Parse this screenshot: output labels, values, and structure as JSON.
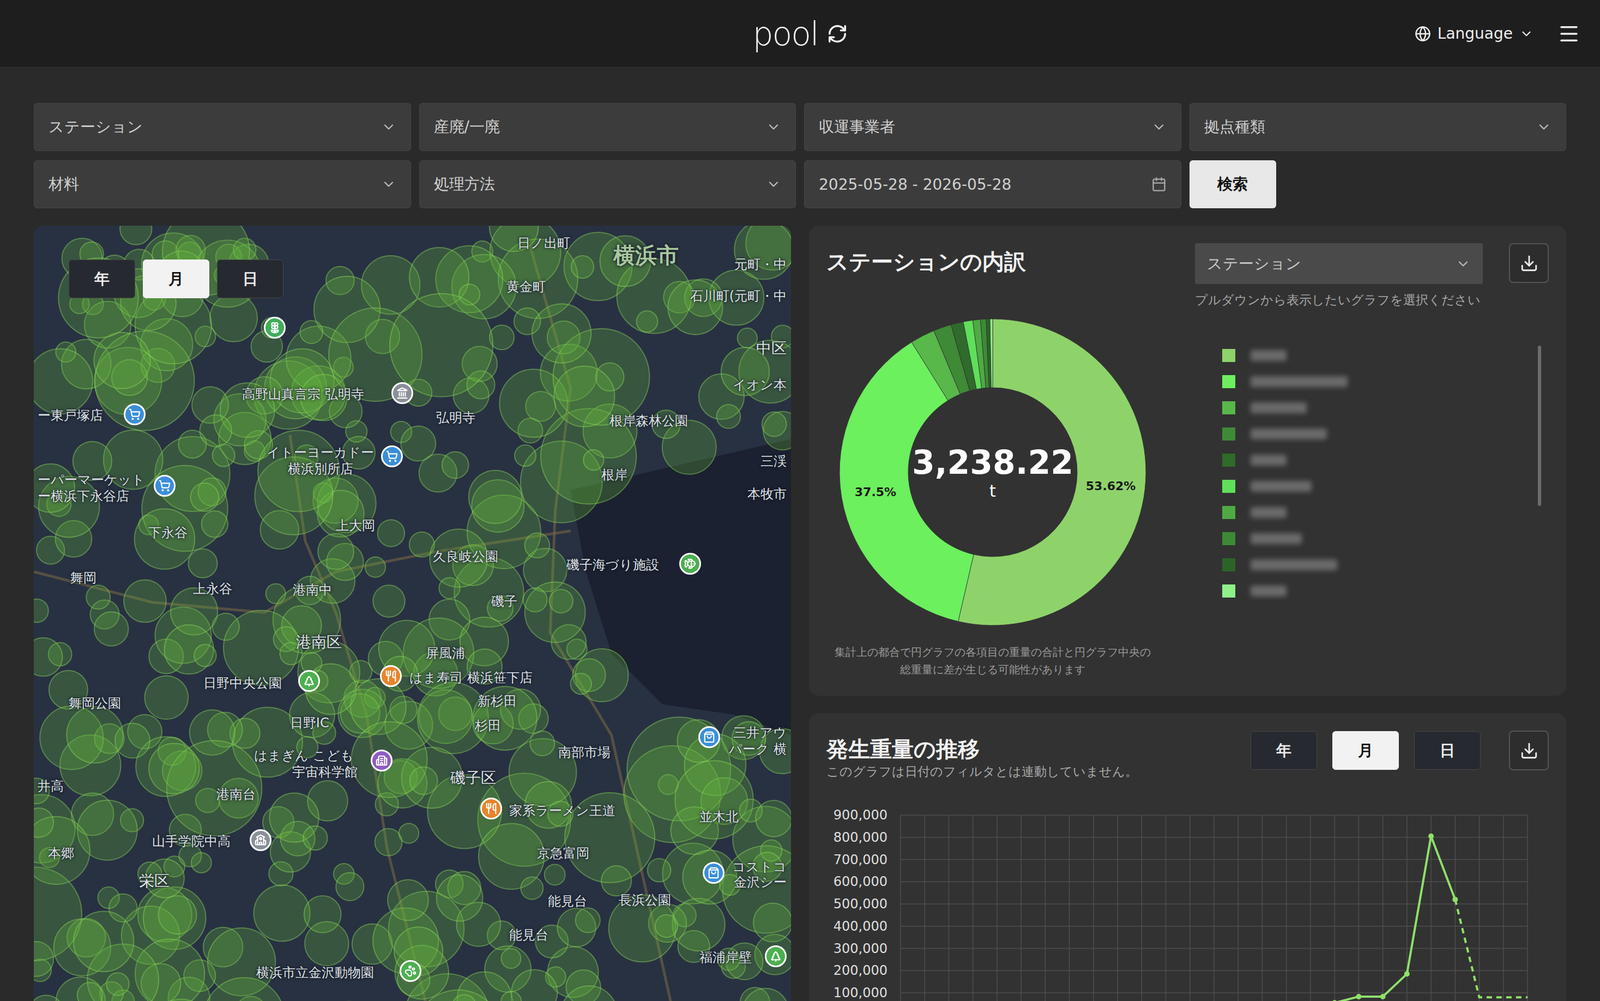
{
  "header": {
    "logo": "pool",
    "language": "Language"
  },
  "filters": [
    {
      "label": "ステーション",
      "kind": "select"
    },
    {
      "label": "産廃/一廃",
      "kind": "select"
    },
    {
      "label": "収運事業者",
      "kind": "select"
    },
    {
      "label": "拠点種類",
      "kind": "select"
    },
    {
      "label": "材料",
      "kind": "select"
    },
    {
      "label": "処理方法",
      "kind": "select"
    },
    {
      "label": "2025-05-28 - 2026-05-28",
      "kind": "date"
    }
  ],
  "search_button": "検索",
  "map": {
    "periods": [
      {
        "label": "年",
        "selected": false
      },
      {
        "label": "月",
        "selected": true
      },
      {
        "label": "日",
        "selected": false
      }
    ],
    "labels": [
      {
        "text": "横浜市",
        "kind": "city"
      },
      {
        "text": "日ノ出町",
        "kind": "place"
      },
      {
        "text": "黄金町",
        "kind": "place"
      },
      {
        "text": "元町・中",
        "kind": "place"
      },
      {
        "text": "石川町(元町・中",
        "kind": "place"
      },
      {
        "text": "中区",
        "kind": "area"
      },
      {
        "text": "イオン本",
        "kind": "place"
      },
      {
        "text": "高野山真言宗 弘明寺",
        "kind": "place"
      },
      {
        "text": "弘明寺",
        "kind": "place"
      },
      {
        "text": "根岸森林公園",
        "kind": "place"
      },
      {
        "text": "ー東戸塚店",
        "kind": "place"
      },
      {
        "text": "イトーヨーカドー",
        "kind": "place"
      },
      {
        "text": "横浜別所店",
        "kind": "place"
      },
      {
        "text": "根岸",
        "kind": "place"
      },
      {
        "text": "本牧市",
        "kind": "place"
      },
      {
        "text": "三渓",
        "kind": "place"
      },
      {
        "text": "ーパーマーケット",
        "kind": "place"
      },
      {
        "text": "ー横浜下永谷店",
        "kind": "place"
      },
      {
        "text": "下永谷",
        "kind": "place"
      },
      {
        "text": "上大岡",
        "kind": "place"
      },
      {
        "text": "久良岐公園",
        "kind": "place"
      },
      {
        "text": "磯子海づり施設",
        "kind": "place"
      },
      {
        "text": "舞岡",
        "kind": "place"
      },
      {
        "text": "上永谷",
        "kind": "place"
      },
      {
        "text": "港南中",
        "kind": "place"
      },
      {
        "text": "磯子",
        "kind": "place"
      },
      {
        "text": "港南区",
        "kind": "area"
      },
      {
        "text": "屏風浦",
        "kind": "place"
      },
      {
        "text": "はま寿司 横浜笹下店",
        "kind": "place"
      },
      {
        "text": "新杉田",
        "kind": "place"
      },
      {
        "text": "杉田",
        "kind": "place"
      },
      {
        "text": "日野中央公園",
        "kind": "place"
      },
      {
        "text": "舞岡公園",
        "kind": "place"
      },
      {
        "text": "日野IC",
        "kind": "place"
      },
      {
        "text": "三井アウ",
        "kind": "place"
      },
      {
        "text": "パーク 横",
        "kind": "place"
      },
      {
        "text": "はまぎん こども",
        "kind": "place"
      },
      {
        "text": "宇宙科学館",
        "kind": "place"
      },
      {
        "text": "南部市場",
        "kind": "place"
      },
      {
        "text": "磯子区",
        "kind": "area"
      },
      {
        "text": "港南台",
        "kind": "place"
      },
      {
        "text": "井高",
        "kind": "place"
      },
      {
        "text": "家系ラーメン王道",
        "kind": "place"
      },
      {
        "text": "並木北",
        "kind": "place"
      },
      {
        "text": "山手学院中高",
        "kind": "place"
      },
      {
        "text": "京急富岡",
        "kind": "place"
      },
      {
        "text": "本郷",
        "kind": "place"
      },
      {
        "text": "コストコ",
        "kind": "place"
      },
      {
        "text": "金沢シー",
        "kind": "place"
      },
      {
        "text": "栄区",
        "kind": "area"
      },
      {
        "text": "能見台",
        "kind": "place"
      },
      {
        "text": "長浜公園",
        "kind": "place"
      },
      {
        "text": "能見台",
        "kind": "place"
      },
      {
        "text": "福浦岸壁",
        "kind": "place"
      },
      {
        "text": "横浜市立金沢動物園",
        "kind": "place"
      }
    ],
    "pins": [
      {
        "kind": "flower",
        "color": "#3fae5a"
      },
      {
        "kind": "temple",
        "color": "#8a8f98"
      },
      {
        "kind": "shop",
        "color": "#3b8fd9"
      },
      {
        "kind": "shop",
        "color": "#3b8fd9"
      },
      {
        "kind": "shop",
        "color": "#3b8fd9"
      },
      {
        "kind": "fishing",
        "color": "#4caf50"
      },
      {
        "kind": "park",
        "color": "#4caf50"
      },
      {
        "kind": "food",
        "color": "#e8842c"
      },
      {
        "kind": "museum",
        "color": "#8e5cc4"
      },
      {
        "kind": "food",
        "color": "#e8842c"
      },
      {
        "kind": "bag",
        "color": "#3b8fd9"
      },
      {
        "kind": "bag",
        "color": "#3b8fd9"
      },
      {
        "kind": "school",
        "color": "#8a9099"
      },
      {
        "kind": "zoo",
        "color": "#4caf50"
      },
      {
        "kind": "park",
        "color": "#4caf50"
      }
    ]
  },
  "breakdown": {
    "title": "ステーションの内訳",
    "select": "ステーション",
    "hint": "プルダウンから表示したいグラフを選択ください",
    "total": "3,238.22",
    "unit": "t",
    "segments": [
      {
        "value": 53.62,
        "label": "53.62%",
        "color": "#8ed36a"
      },
      {
        "value": 37.5,
        "label": "37.5%",
        "color": "#6cf05e"
      },
      {
        "value": 2.6,
        "color": "#58b84a"
      },
      {
        "value": 1.9,
        "color": "#3f8a36"
      },
      {
        "value": 1.3,
        "color": "#2f6b2a"
      },
      {
        "value": 1.0,
        "color": "#5ee05a"
      },
      {
        "value": 0.8,
        "color": "#4faa44"
      },
      {
        "value": 0.6,
        "color": "#3d8a34"
      },
      {
        "value": 0.4,
        "color": "#2c6428"
      },
      {
        "value": 0.28,
        "color": "#8ff08a"
      }
    ],
    "note": [
      "集計上の都合で円グラフの各項目の重量の合計と円グラフ中央の",
      "総重量に差が生じる可能性があります"
    ]
  },
  "trend": {
    "title": "発生重量の推移",
    "subtitle": "このグラフは日付のフィルタとは連動していません。",
    "periods": [
      {
        "label": "年",
        "selected": false
      },
      {
        "label": "月",
        "selected": true
      },
      {
        "label": "日",
        "selected": false
      }
    ],
    "y_ticks": [
      "900,000",
      "800,000",
      "700,000",
      "600,000",
      "500,000",
      "400,000",
      "300,000",
      "200,000",
      "100,000"
    ],
    "actual": [
      0,
      0,
      0,
      0,
      0,
      0,
      0,
      0,
      0,
      0,
      0,
      0,
      0,
      0,
      0,
      0,
      0,
      0,
      55000,
      83000,
      83000,
      185000,
      805000,
      520000
    ],
    "forecast": [
      80000,
      80000,
      80000
    ]
  }
}
